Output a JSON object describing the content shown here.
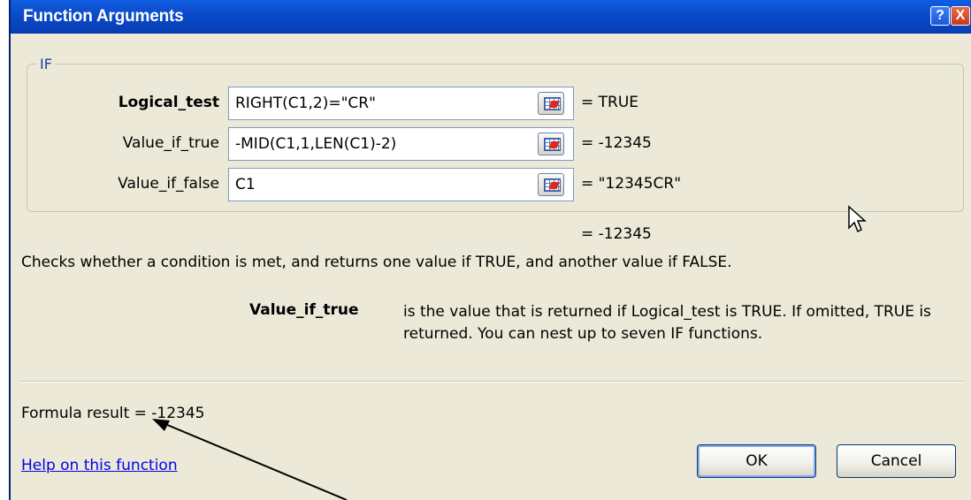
{
  "window": {
    "title": "Function Arguments",
    "help_button": "?",
    "close_button": "X"
  },
  "function_group": {
    "name": "IF",
    "arguments": [
      {
        "label": "Logical_test",
        "value": "RIGHT(C1,2)=\"CR\"",
        "result": "=  TRUE",
        "bold": true
      },
      {
        "label": "Value_if_true",
        "value": "-MID(C1,1,LEN(C1)-2)",
        "result": "=  -12345",
        "bold": false
      },
      {
        "label": "Value_if_false",
        "value": "C1",
        "result": "=  \"12345CR\"",
        "bold": false
      }
    ]
  },
  "overall_result": "=  -12345",
  "description": "Checks whether a condition is met, and returns one value if TRUE, and another value if FALSE.",
  "argument_help": {
    "name": "Value_if_true",
    "text": "is the value that is returned if Logical_test is TRUE. If omitted, TRUE is returned. You can nest up to seven IF functions."
  },
  "formula_result": "Formula result =   -12345",
  "help_link": "Help on this function",
  "buttons": {
    "ok": "OK",
    "cancel": "Cancel"
  },
  "colors": {
    "titlebar": "#0a48c8",
    "dialog_bg": "#ece9d8",
    "link": "#0000ee"
  }
}
